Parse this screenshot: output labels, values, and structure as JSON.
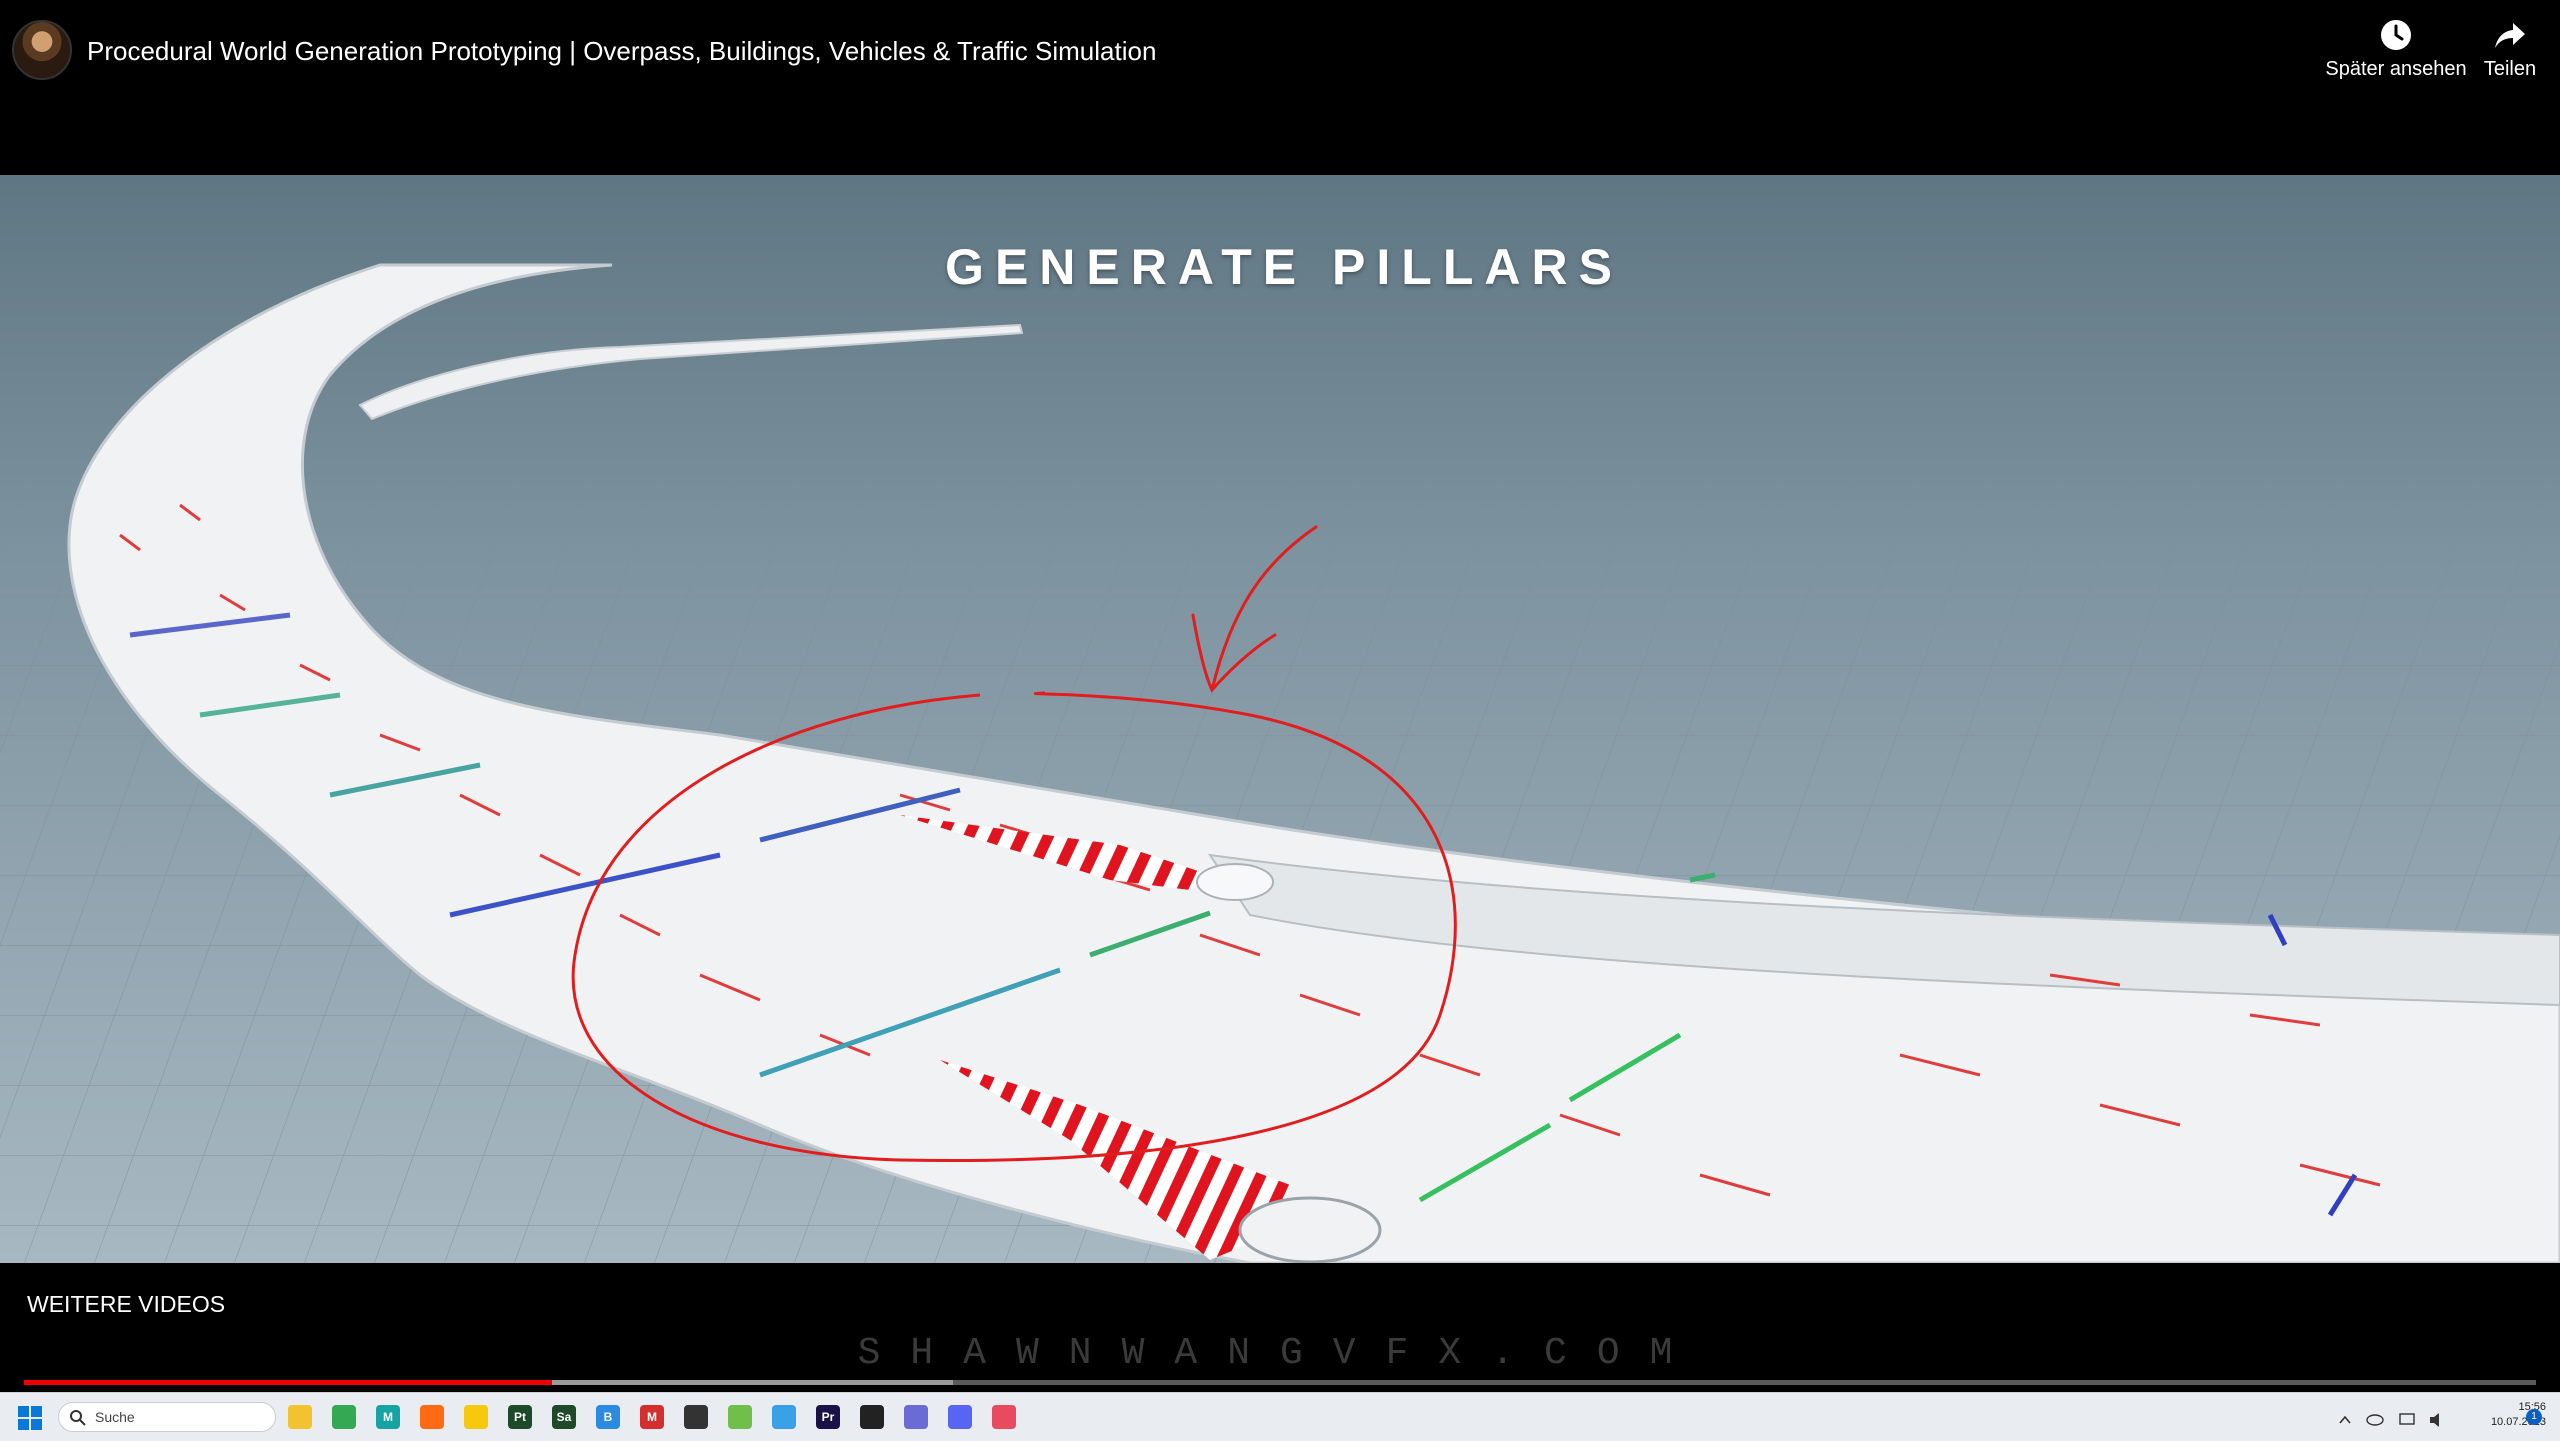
{
  "video": {
    "title": "Procedural World Generation Prototyping | Overpass, Buildings, Vehicles & Traffic Simulation",
    "overlay_heading": "GENERATE PILLARS",
    "watermark": "SHAWNWANGVFX.COM",
    "played_fraction": 0.21,
    "loaded_fraction": 0.37
  },
  "actions": {
    "watch_later": "Später ansehen",
    "share": "Teilen"
  },
  "player": {
    "more_videos": "WEITERE VIDEOS"
  },
  "taskbar": {
    "search_placeholder": "Suche",
    "apps": [
      {
        "name": "file-explorer",
        "color": "#f2c230",
        "glyph": ""
      },
      {
        "name": "chrome",
        "color": "#34a853",
        "glyph": ""
      },
      {
        "name": "app-m",
        "color": "#16a3a3",
        "glyph": "M"
      },
      {
        "name": "houdini",
        "color": "#ff6a13",
        "glyph": ""
      },
      {
        "name": "nuke",
        "color": "#f6c90e",
        "glyph": ""
      },
      {
        "name": "substance-painter",
        "color": "#1e4a2a",
        "glyph": "Pt"
      },
      {
        "name": "substance-sampler",
        "color": "#1e4a2a",
        "glyph": "Sa"
      },
      {
        "name": "app-b",
        "color": "#2b8ae2",
        "glyph": "B"
      },
      {
        "name": "app-red",
        "color": "#d32f2f",
        "glyph": "M"
      },
      {
        "name": "app-figure",
        "color": "#333333",
        "glyph": ""
      },
      {
        "name": "app-house",
        "color": "#6fbf4a",
        "glyph": ""
      },
      {
        "name": "mail",
        "color": "#3aa0e8",
        "glyph": ""
      },
      {
        "name": "premiere",
        "color": "#1a1247",
        "glyph": "Pr"
      },
      {
        "name": "app-dark",
        "color": "#222222",
        "glyph": ""
      },
      {
        "name": "app-circle",
        "color": "#6b6bd6",
        "glyph": ""
      },
      {
        "name": "discord",
        "color": "#5865f2",
        "glyph": ""
      },
      {
        "name": "snipping",
        "color": "#e84a5f",
        "glyph": ""
      }
    ],
    "time": "15:56",
    "date": "10.07.2023",
    "notification_count": "1"
  }
}
